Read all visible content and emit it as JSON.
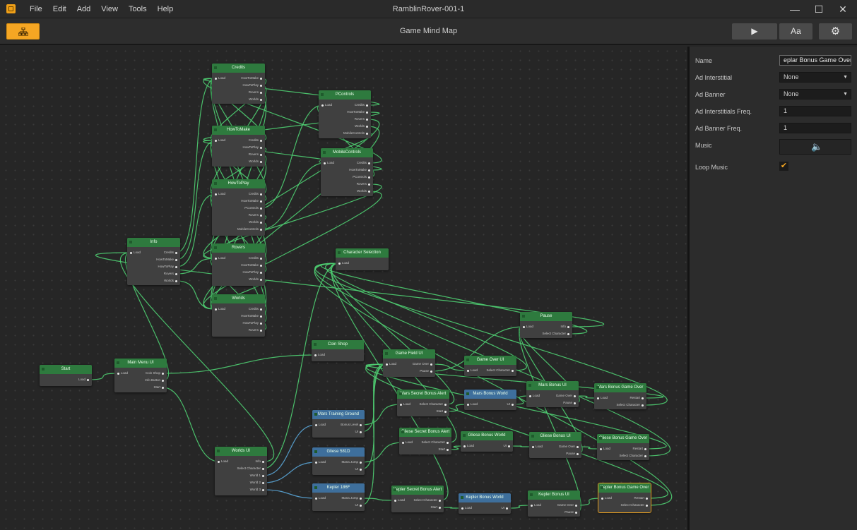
{
  "app": {
    "icon": "app-cube-icon",
    "title": "RamblinRover-001-1",
    "menu": [
      "File",
      "Edit",
      "Add",
      "View",
      "Tools",
      "Help"
    ],
    "window_controls": {
      "minimize": "—",
      "maximize": "☐",
      "close": "✕"
    }
  },
  "toolbar": {
    "title": "Game Mind Map",
    "mindmap_button_icon": "hierarchy-icon",
    "play_label": "▶",
    "font_label": "Aa",
    "settings_label": "⚙",
    "accent": "#f5a623"
  },
  "colors": {
    "node_header_green": "#2e7a3e",
    "node_header_blue": "#3e6f9c",
    "wire": "#4fcf72",
    "selected_outline": "#e8a020"
  },
  "nodes": {
    "credits": {
      "title": "Credits",
      "inputs": [
        "Load"
      ],
      "outputs": [
        "HowToMake",
        "HowToPlay",
        "Rovers",
        "Worlds"
      ]
    },
    "howtomake": {
      "title": "HowToMake",
      "inputs": [
        "Load"
      ],
      "outputs": [
        "Credits",
        "HowToPlay",
        "Rovers",
        "Worlds"
      ]
    },
    "howtoplay": {
      "title": "HowToPlay",
      "inputs": [
        "Load"
      ],
      "outputs": [
        "Credits",
        "HowToMake",
        "PControls",
        "Rovers",
        "Worlds",
        "MobileControls"
      ]
    },
    "rovers": {
      "title": "Rovers",
      "inputs": [
        "Load"
      ],
      "outputs": [
        "Credits",
        "HowToMake",
        "HowToPlay",
        "Worlds"
      ]
    },
    "worlds": {
      "title": "Worlds",
      "inputs": [
        "Load"
      ],
      "outputs": [
        "Credits",
        "HowToMake",
        "HowToPlay",
        "Rovers"
      ]
    },
    "pcontrols": {
      "title": "PControls",
      "inputs": [
        "Load"
      ],
      "outputs": [
        "Credits",
        "HowToMake",
        "Rovers",
        "Worlds",
        "MobileControls"
      ]
    },
    "mobilecontrols": {
      "title": "MobileControls",
      "inputs": [
        "Load"
      ],
      "outputs": [
        "Credits",
        "HowToMake",
        "PControls",
        "Rovers",
        "Worlds"
      ]
    },
    "info": {
      "title": "Info",
      "inputs": [
        "Load"
      ],
      "outputs": [
        "Credits",
        "HowToMake",
        "HowToPlay",
        "Rovers",
        "Worlds"
      ]
    },
    "character_selection": {
      "title": "Character Selection",
      "inputs": [
        "Load"
      ],
      "outputs": []
    },
    "start": {
      "title": "Start",
      "inputs": [],
      "outputs": [
        "Load"
      ]
    },
    "main_menu_ui": {
      "title": "Main Menu UI",
      "inputs": [
        "Load"
      ],
      "outputs": [
        "Coin Shop",
        "Info Button",
        "Start"
      ]
    },
    "coin_shop": {
      "title": "Coin Shop",
      "inputs": [
        "Load"
      ],
      "outputs": []
    },
    "game_field_ui": {
      "title": "Game Field UI",
      "inputs": [
        "Load"
      ],
      "outputs": [
        "Game Over",
        "Pause"
      ]
    },
    "game_over_ui": {
      "title": "Game Over UI",
      "inputs": [
        "Load"
      ],
      "outputs": [
        "Select Character"
      ]
    },
    "pause": {
      "title": "Pause",
      "inputs": [
        "Load"
      ],
      "outputs": [
        "Info",
        "Select Character"
      ]
    },
    "mars_secret_bonus_alert": {
      "title": "Mars Secret Bonus Alert",
      "inputs": [
        "Load"
      ],
      "outputs": [
        "Select Character",
        "Start"
      ]
    },
    "mars_bonus_world": {
      "title": "Mars Bonus World",
      "inputs": [
        "Load"
      ],
      "outputs": [
        "UI"
      ]
    },
    "mars_bonus_ui": {
      "title": "Mars Bonus UI",
      "inputs": [
        "Load"
      ],
      "outputs": [
        "Game Over",
        "Pause"
      ]
    },
    "mars_bonus_game_over": {
      "title": "Mars Bonus Game Over",
      "inputs": [
        "Load"
      ],
      "outputs": [
        "Restart",
        "Select Character"
      ]
    },
    "mars_training_ground": {
      "title": "Mars Training Ground",
      "inputs": [
        "Load"
      ],
      "outputs": [
        "Bonus Level",
        "UI"
      ]
    },
    "gliese_secret_bonus_alert": {
      "title": "Gliese Secret Bonus Alert",
      "inputs": [
        "Load"
      ],
      "outputs": [
        "Select Character",
        "Start"
      ]
    },
    "gliese_bonus_world": {
      "title": "Gliese Bonus World",
      "inputs": [
        "Load"
      ],
      "outputs": [
        "UI"
      ]
    },
    "gliese_bonus_ui": {
      "title": "Gliese Bonus UI",
      "inputs": [
        "Load"
      ],
      "outputs": [
        "Game Over",
        "Pause"
      ]
    },
    "gliese_bonus_game_over": {
      "title": "Gliese Bonus Game Over",
      "inputs": [
        "Load"
      ],
      "outputs": [
        "Restart",
        "Select Character"
      ]
    },
    "gliese_581d": {
      "title": "Gliese 581D",
      "inputs": [
        "Load"
      ],
      "outputs": [
        "Mana Jump",
        "UI"
      ]
    },
    "worlds_ui": {
      "title": "Worlds UI",
      "inputs": [
        "Load"
      ],
      "outputs": [
        "Info",
        "Select Character",
        "World 1",
        "World 2",
        "World 3"
      ]
    },
    "kepler_186f": {
      "title": "Kepler 186F",
      "inputs": [
        "Load"
      ],
      "outputs": [
        "Mana Jump",
        "UI"
      ]
    },
    "kepler_secret_bonus_alert": {
      "title": "Kepler Secret Bonus Alert",
      "inputs": [
        "Load"
      ],
      "outputs": [
        "Select Character",
        "Start"
      ]
    },
    "kepler_bonus_world": {
      "title": "Kepler Bonus World",
      "inputs": [
        "Load"
      ],
      "outputs": [
        "UI"
      ]
    },
    "kepler_bonus_ui": {
      "title": "Kepler Bonus UI",
      "inputs": [
        "Load"
      ],
      "outputs": [
        "Game Over",
        "Pause"
      ]
    },
    "kepler_bonus_game_over": {
      "title": "Kepler Bonus Game Over",
      "inputs": [
        "Load"
      ],
      "outputs": [
        "Restart",
        "Select Character"
      ]
    }
  },
  "properties": {
    "name_label": "Name",
    "name_value": "eplar Bonus Game Over",
    "ad_interstitial_label": "Ad Interstitial",
    "ad_interstitial_value": "None",
    "ad_banner_label": "Ad Banner",
    "ad_banner_value": "None",
    "ad_interstitials_freq_label": "Ad Interstitials Freq.",
    "ad_interstitials_freq_value": "1",
    "ad_banner_freq_label": "Ad Banner Freq.",
    "ad_banner_freq_value": "1",
    "music_label": "Music",
    "music_icon": "speaker-icon",
    "music_glyph": "🔈",
    "loop_music_label": "Loop Music",
    "loop_music_checked": true,
    "check_glyph": "✔",
    "dropdown_glyph": "▼"
  }
}
